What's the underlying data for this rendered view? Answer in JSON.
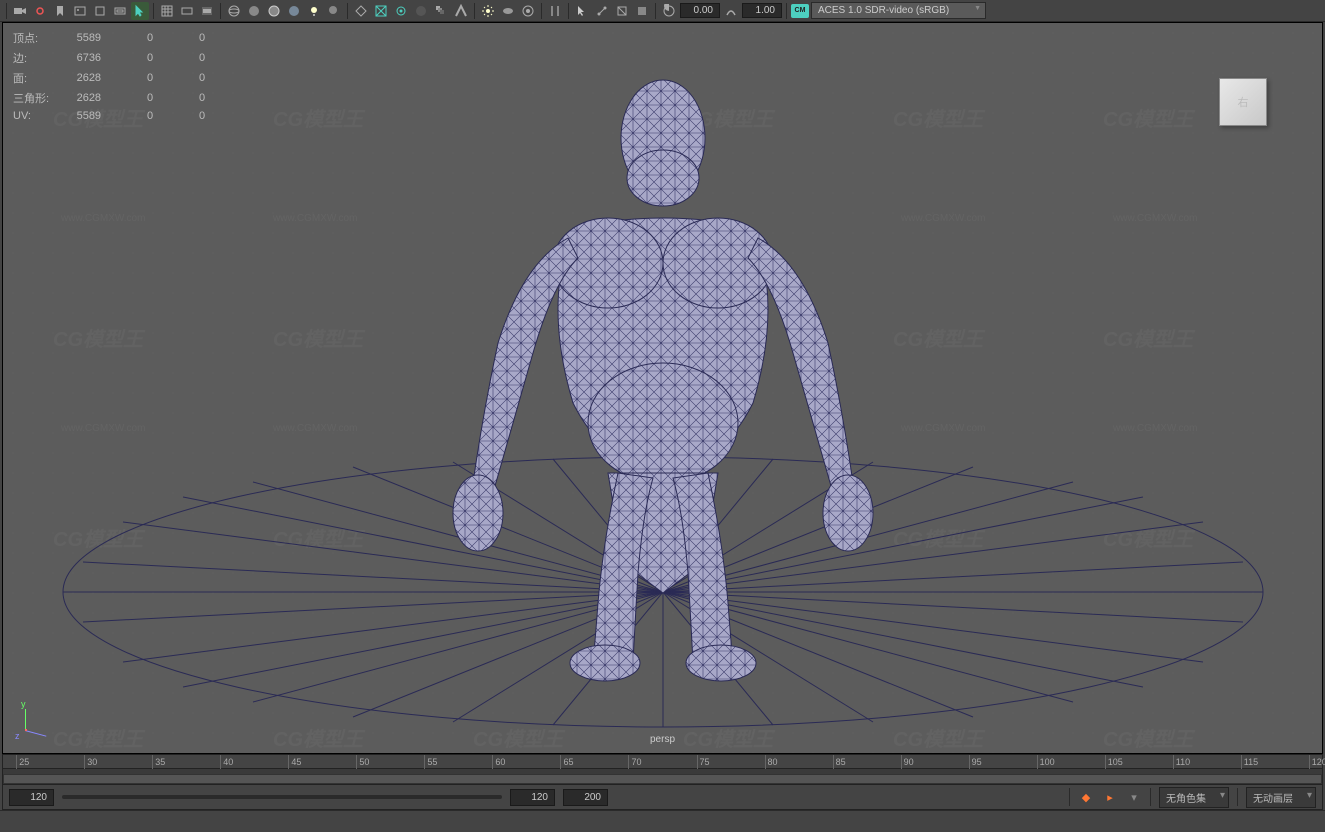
{
  "toolbar": {
    "num1": "0.00",
    "num2": "1.00",
    "cm_badge": "CM",
    "colorspace": "ACES 1.0 SDR-video (sRGB)"
  },
  "hud": {
    "rows": [
      {
        "label": "顶点:",
        "v1": "5589",
        "v2": "0",
        "v3": "0"
      },
      {
        "label": "边:",
        "v1": "6736",
        "v2": "0",
        "v3": "0"
      },
      {
        "label": "面:",
        "v1": "2628",
        "v2": "0",
        "v3": "0"
      },
      {
        "label": "三角形:",
        "v1": "2628",
        "v2": "0",
        "v3": "0"
      },
      {
        "label": "UV:",
        "v1": "5589",
        "v2": "0",
        "v3": "0"
      }
    ]
  },
  "viewcube": {
    "face": "右"
  },
  "axis": {
    "y": "y",
    "z": "z"
  },
  "camera": "persp",
  "timeline": {
    "ticks": [
      "25",
      "30",
      "35",
      "40",
      "45",
      "50",
      "55",
      "60",
      "65",
      "70",
      "75",
      "80",
      "85",
      "90",
      "95",
      "100",
      "105",
      "110",
      "115",
      "120"
    ]
  },
  "bottombar": {
    "frame": "120",
    "range_start": "120",
    "range_end": "200",
    "character_set": "无角色集",
    "anim_layer": "无动画层"
  },
  "watermarks": {
    "logo": "CG模型王",
    "url": "www.CGMXW.com"
  }
}
